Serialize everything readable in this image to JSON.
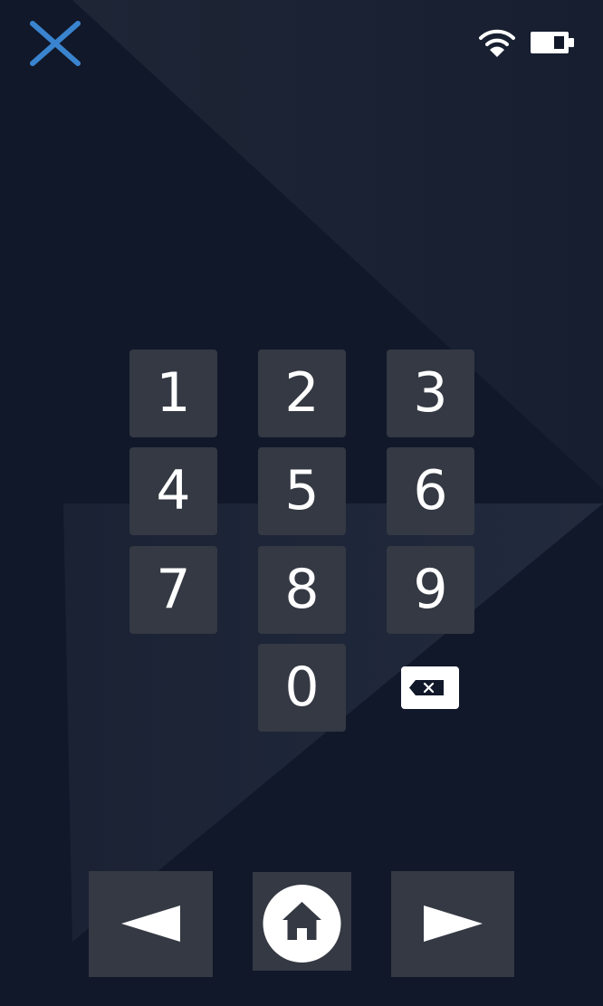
{
  "keypad": {
    "keys": [
      "1",
      "2",
      "3",
      "4",
      "5",
      "6",
      "7",
      "8",
      "9",
      "0"
    ]
  },
  "icons": {
    "close": "close-icon",
    "wifi": "wifi-icon",
    "battery": "battery-icon",
    "backspace": "backspace-icon",
    "back": "back-arrow-icon",
    "home": "home-icon",
    "forward": "forward-arrow-icon"
  },
  "colors": {
    "background": "#111829",
    "key": "#343943",
    "accent": "#3a84cf",
    "text": "#ffffff"
  }
}
